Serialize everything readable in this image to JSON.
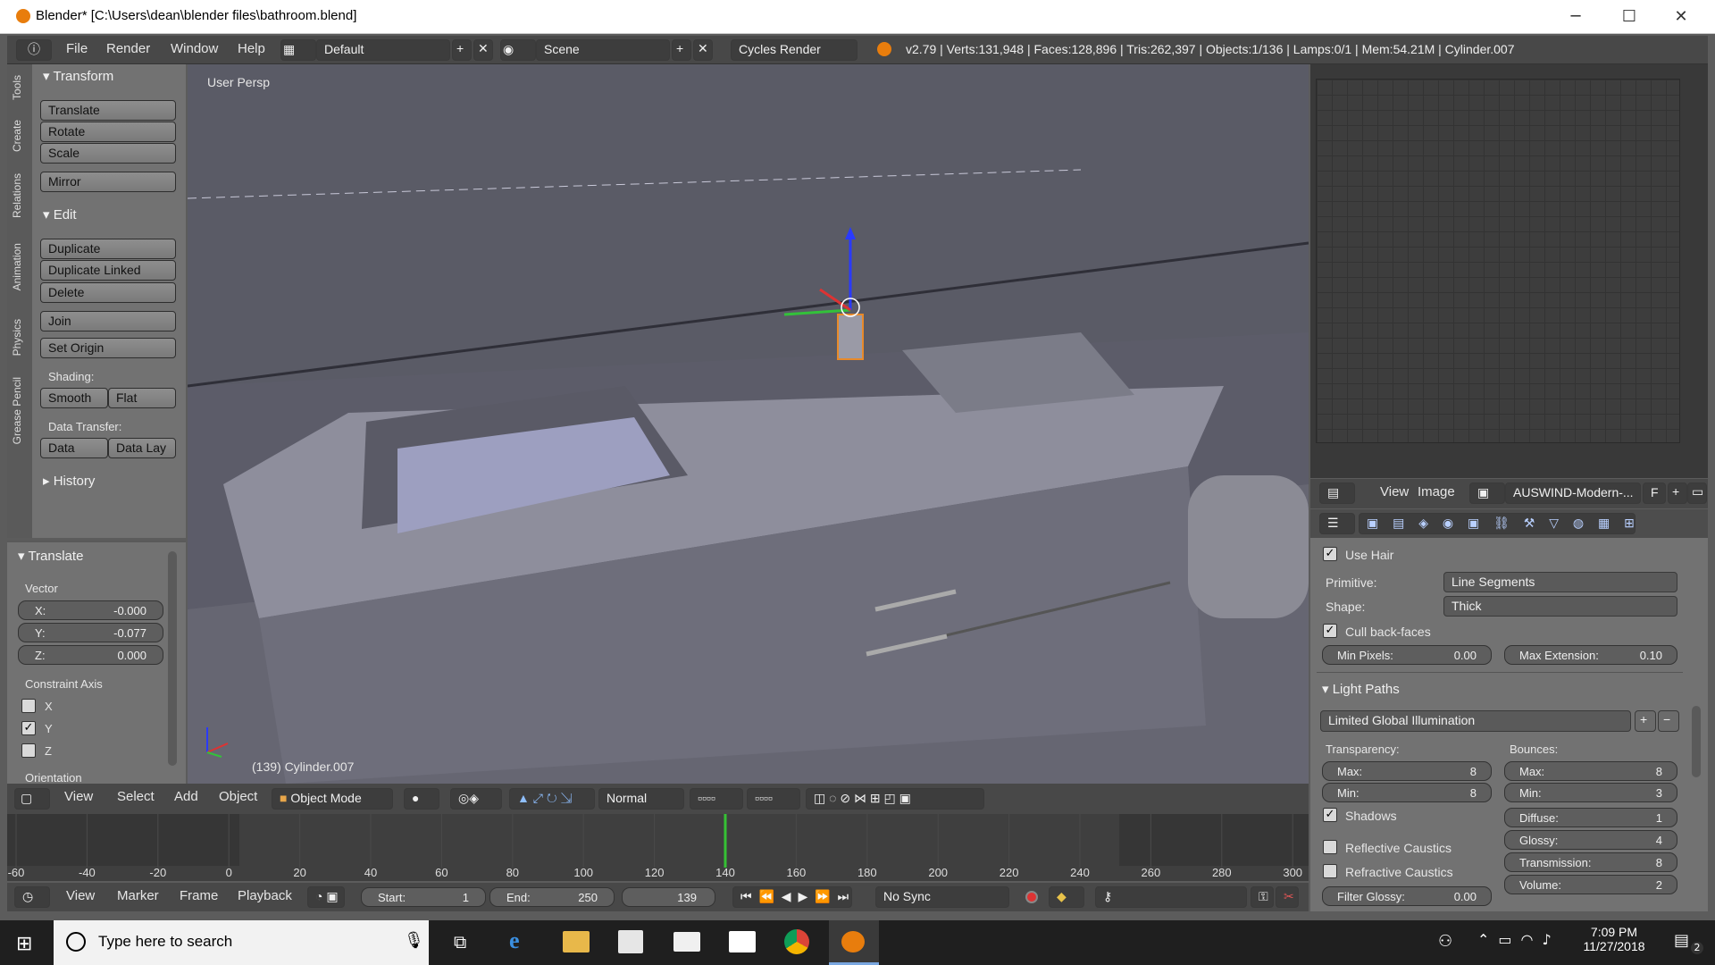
{
  "window": {
    "title": "Blender* [C:\\Users\\dean\\blender files\\bathroom.blend]",
    "minimize": "─",
    "maximize": "☐",
    "close": "✕"
  },
  "menubar": {
    "items": [
      "File",
      "Render",
      "Window",
      "Help"
    ],
    "layout": "Default",
    "scene": "Scene",
    "engine": "Cycles Render",
    "stats": "v2.79 | Verts:131,948 | Faces:128,896 | Tris:262,397 | Objects:1/136 | Lamps:0/1 | Mem:54.21M | Cylinder.007"
  },
  "tool_tabs": [
    "Tools",
    "Create",
    "Relations",
    "Animation",
    "Physics",
    "Grease Pencil"
  ],
  "toolshelf": {
    "transform_header": "Transform",
    "translate": "Translate",
    "rotate": "Rotate",
    "scale": "Scale",
    "mirror": "Mirror",
    "edit_header": "Edit",
    "duplicate": "Duplicate",
    "duplicate_linked": "Duplicate Linked",
    "delete": "Delete",
    "join": "Join",
    "set_origin": "Set Origin",
    "shading_label": "Shading:",
    "smooth": "Smooth",
    "flat": "Flat",
    "data_transfer_label": "Data Transfer:",
    "data": "Data",
    "data_lay": "Data Lay",
    "history_header": "History"
  },
  "operator_panel": {
    "header": "Translate",
    "vector_label": "Vector",
    "x_label": "X:",
    "x": "-0.000",
    "y_label": "Y:",
    "y": "-0.077",
    "z_label": "Z:",
    "z": "0.000",
    "constraint_label": "Constraint Axis",
    "axis_x": "X",
    "axis_y": "Y",
    "axis_z": "Z",
    "x_checked": false,
    "y_checked": true,
    "z_checked": false,
    "orientation_label": "Orientation"
  },
  "viewport": {
    "view_label": "User Persp",
    "object_label": "(139) Cylinder.007"
  },
  "viewport_header": {
    "menus": [
      "View",
      "Select",
      "Add",
      "Object"
    ],
    "mode": "Object Mode",
    "pivot": "Normal"
  },
  "timeline": {
    "ticks": [
      "-60",
      "-40",
      "-20",
      "0",
      "20",
      "40",
      "60",
      "80",
      "100",
      "120",
      "140",
      "160",
      "180",
      "200",
      "220",
      "240",
      "260",
      "280",
      "300"
    ],
    "current_frame": 140
  },
  "timeline_header": {
    "menus": [
      "View",
      "Marker",
      "Frame",
      "Playback"
    ],
    "start_label": "Start:",
    "start": "1",
    "end_label": "End:",
    "end": "250",
    "frame": "139",
    "sync": "No Sync"
  },
  "uv_header": {
    "view": "View",
    "image": "Image",
    "image_name": "AUSWIND-Modern-...",
    "f": "F"
  },
  "properties": {
    "use_hair": "Use Hair",
    "primitive_label": "Primitive:",
    "primitive": "Line Segments",
    "shape_label": "Shape:",
    "shape": "Thick",
    "cull_backfaces": "Cull back-faces",
    "min_pixels_label": "Min Pixels:",
    "min_pixels": "0.00",
    "max_ext_label": "Max Extension:",
    "max_ext": "0.10",
    "light_paths_header": "Light Paths",
    "preset": "Limited Global Illumination",
    "transparency_label": "Transparency:",
    "t_max_label": "Max:",
    "t_max": "8",
    "t_min_label": "Min:",
    "t_min": "8",
    "bounces_label": "Bounces:",
    "b_max_label": "Max:",
    "b_max": "8",
    "b_min_label": "Min:",
    "b_min": "3",
    "shadows": "Shadows",
    "diffuse_label": "Diffuse:",
    "diffuse": "1",
    "glossy_label": "Glossy:",
    "glossy": "4",
    "reflective": "Reflective Caustics",
    "transmission_label": "Transmission:",
    "transmission": "8",
    "refractive": "Refractive Caustics",
    "volume_label": "Volume:",
    "volume": "2",
    "filter_glossy_label": "Filter Glossy:",
    "filter_glossy": "0.00"
  },
  "taskbar": {
    "search_placeholder": "Type here to search",
    "time": "7:09 PM",
    "date": "11/27/2018",
    "notif_count": "2"
  },
  "colors": {
    "blender_orange": "#e87d0d",
    "panel": "#727272",
    "header": "#484848",
    "viewport": "#5c5c69"
  }
}
